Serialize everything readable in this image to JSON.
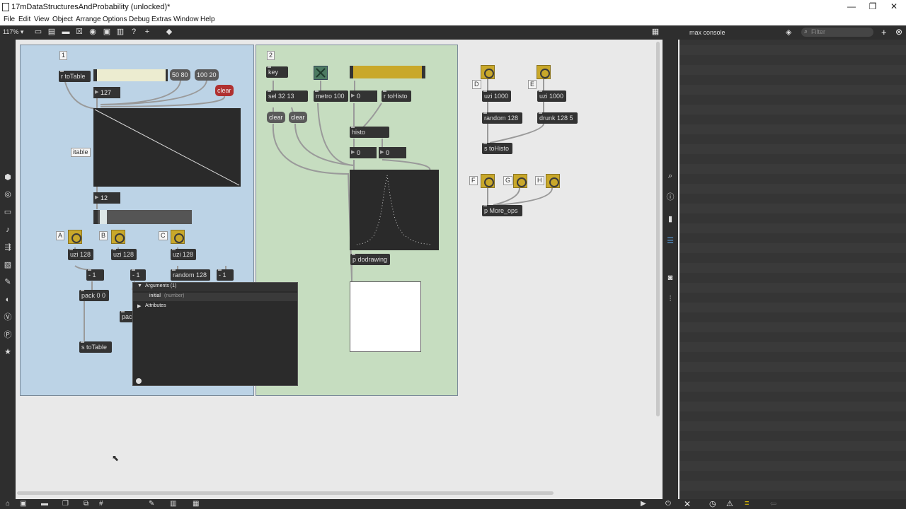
{
  "window": {
    "title": "17mDataStructuresAndProbability (unlocked)*",
    "min": "—",
    "max": "❐",
    "close": "✕"
  },
  "menu": [
    "File",
    "Edit",
    "View",
    "Object",
    "Arrange",
    "Options",
    "Debug",
    "Extras",
    "Window",
    "Help"
  ],
  "toolbar": {
    "zoom": "117% ▾"
  },
  "console": {
    "title": "max console",
    "filter_placeholder": "Filter",
    "add": "+",
    "clear": "✕"
  },
  "panel1": {
    "label": "1",
    "receive": "r toTable",
    "msg_50_80": "50 80",
    "msg_100_20": "100 20",
    "clear": "clear",
    "num_127": "127",
    "itable": "itable",
    "num_12": "12",
    "labels": [
      "A",
      "B",
      "C"
    ],
    "uzi_a": "uzi 128",
    "uzi_b": "uzi 128",
    "uzi_c": "uzi 128",
    "minus1_a": "- 1",
    "minus1_b": "- 1",
    "random": "random 128",
    "minus1_c": "- 1",
    "pack": "pack 0 0",
    "pack2": "pac",
    "send": "s toTable"
  },
  "inspector": {
    "section_args": "Arguments (1)",
    "arg_name": "initial",
    "arg_type": "(number)",
    "section_attrs": "Attributes"
  },
  "panel2": {
    "label": "2",
    "key": "key",
    "sel": "sel 32 13",
    "metro": "metro 100",
    "num_0a": "0",
    "receive": "r toHisto",
    "clear1": "clear",
    "clear2": "clear",
    "histo": "histo",
    "num_0b": "0",
    "num_0c": "0",
    "dodrawing": "p dodrawing"
  },
  "right": {
    "label_d": "D",
    "label_e": "E",
    "uzi_d": "uzi 1000",
    "uzi_e": "uzi 1000",
    "random": "random 128",
    "drunk": "drunk 128 5",
    "send": "s toHisto",
    "label_f": "F",
    "label_g": "G",
    "label_h": "H",
    "more_ops": "p More_ops"
  },
  "colors": {
    "panel1": "#bcd3e6",
    "panel2": "#c6ddc0",
    "button": "#c9a82a",
    "objbg": "#333333"
  }
}
